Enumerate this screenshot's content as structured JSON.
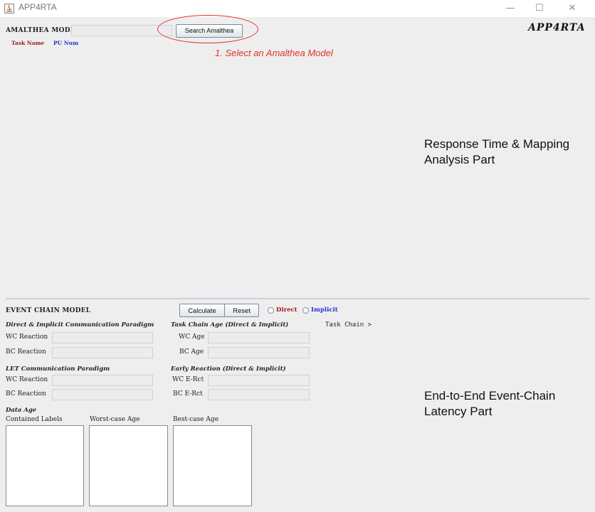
{
  "window": {
    "title": "APP4RTA",
    "minimize_icon": "—",
    "maximize_icon": "☐",
    "close_icon": "✕"
  },
  "top": {
    "amalthea_label": "AMALTHEA MODEL",
    "amalthea_value": "",
    "search_button": "Search Amalthea",
    "step_caption": "1. Select an Amalthea Model",
    "logo": "APP4RTA",
    "columns": {
      "task_name": "Task Name",
      "pu_num": "PU Num"
    },
    "annotation": "Response Time & Mapping Analysis Part"
  },
  "event_chain": {
    "label": "EVENT CHAIN MODEL",
    "calculate_button": "Calculate",
    "reset_button": "Reset",
    "radio_direct": "Direct",
    "radio_implicit": "Implicit",
    "task_chain_label": "Task Chain >",
    "direct_implicit": {
      "title": "Direct & Implicit Communication Paradigm",
      "wc_reaction": "WC Reaction",
      "bc_reaction": "BC Reaction"
    },
    "task_chain_age": {
      "title": "Task Chain Age (Direct & Implicit)",
      "wc_age": "WC Age",
      "bc_age": "BC Age"
    },
    "let": {
      "title": "LET Communication Paradigm",
      "wc_reaction": "WC Reaction",
      "bc_reaction": "BC Reaction"
    },
    "early_reaction": {
      "title": "Early Reaction (Direct & Implicit)",
      "wc_ercet": "WC E-Rct",
      "bc_ercet": "BC E-Rct"
    },
    "data_age": {
      "title": "Data Age",
      "contained_labels": "Contained Labels",
      "worst_case_age": "Worst-case Age",
      "best_case_age": "Best-case Age"
    },
    "annotation": "End-to-End Event-Chain Latency Part"
  },
  "colors": {
    "red_annotation": "#e0302a",
    "task_name": "#9a1a1a",
    "pu_num": "#2233cc"
  }
}
